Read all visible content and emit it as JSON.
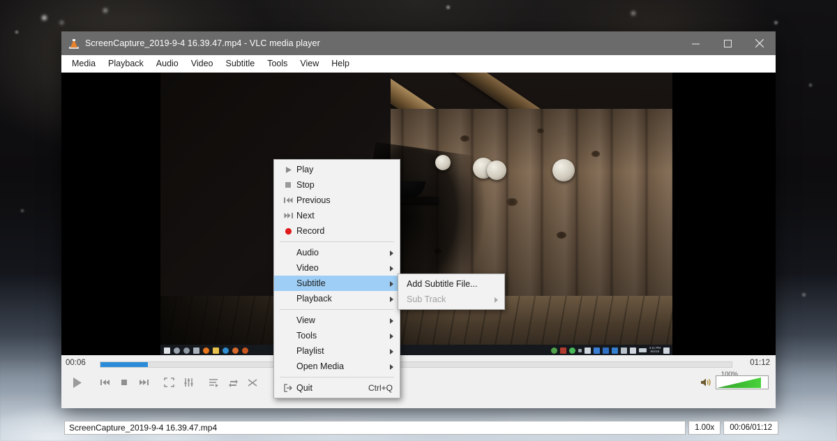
{
  "window": {
    "title": "ScreenCapture_2019-9-4 16.39.47.mp4 - VLC media player",
    "app_icon": "vlc-cone-icon",
    "controls": {
      "minimize": "minimize-icon",
      "maximize": "maximize-icon",
      "close": "close-icon"
    }
  },
  "menubar": {
    "items": [
      {
        "label": "Media"
      },
      {
        "label": "Playback"
      },
      {
        "label": "Audio"
      },
      {
        "label": "Video"
      },
      {
        "label": "Subtitle"
      },
      {
        "label": "Tools"
      },
      {
        "label": "View"
      },
      {
        "label": "Help"
      }
    ]
  },
  "context_menu": {
    "items": [
      {
        "label": "Play",
        "icon": "play-icon",
        "type": "action"
      },
      {
        "label": "Stop",
        "icon": "stop-icon",
        "type": "action"
      },
      {
        "label": "Previous",
        "icon": "previous-icon",
        "type": "action"
      },
      {
        "label": "Next",
        "icon": "next-icon",
        "type": "action"
      },
      {
        "label": "Record",
        "icon": "record-icon",
        "type": "action"
      },
      {
        "label": "Audio",
        "icon": "",
        "type": "submenu"
      },
      {
        "label": "Video",
        "icon": "",
        "type": "submenu"
      },
      {
        "label": "Subtitle",
        "icon": "",
        "type": "submenu",
        "highlighted": true
      },
      {
        "label": "Playback",
        "icon": "",
        "type": "submenu"
      },
      {
        "label": "View",
        "icon": "",
        "type": "submenu"
      },
      {
        "label": "Tools",
        "icon": "",
        "type": "submenu"
      },
      {
        "label": "Playlist",
        "icon": "",
        "type": "submenu"
      },
      {
        "label": "Open Media",
        "icon": "",
        "type": "submenu"
      },
      {
        "label": "Quit",
        "icon": "quit-icon",
        "type": "action",
        "shortcut": "Ctrl+Q"
      }
    ],
    "highlight_color": "#9ecef5"
  },
  "submenu": {
    "items": [
      {
        "label": "Add Subtitle File...",
        "disabled": false
      },
      {
        "label": "Sub Track",
        "disabled": true,
        "type": "submenu"
      }
    ]
  },
  "controls": {
    "elapsed": "00:06",
    "total": "01:12",
    "progress_percent": 7.5,
    "buttons": [
      {
        "name": "play-button",
        "icon": "play-icon"
      },
      {
        "name": "previous-button",
        "icon": "previous-icon"
      },
      {
        "name": "stop-button",
        "icon": "stop-icon"
      },
      {
        "name": "next-button",
        "icon": "next-icon"
      },
      {
        "name": "fullscreen-button",
        "icon": "fullscreen-icon"
      },
      {
        "name": "equalizer-button",
        "icon": "equalizer-icon"
      },
      {
        "name": "playlist-button",
        "icon": "playlist-icon"
      },
      {
        "name": "loop-button",
        "icon": "loop-icon"
      },
      {
        "name": "shuffle-button",
        "icon": "shuffle-icon"
      }
    ],
    "volume": {
      "label": "100%",
      "level": 100,
      "icon": "speaker-icon",
      "color": "#3fbf33"
    }
  },
  "status": {
    "filename": "ScreenCapture_2019-9-4 16.39.47.mp4",
    "speed": "1.00x",
    "time": "00:06/01:12"
  },
  "colors": {
    "titlebar": "#6b6b6b",
    "progress_fill": "#2a8bd8",
    "menu_highlight": "#9ecef5",
    "chrome": "#f0f0f0"
  }
}
